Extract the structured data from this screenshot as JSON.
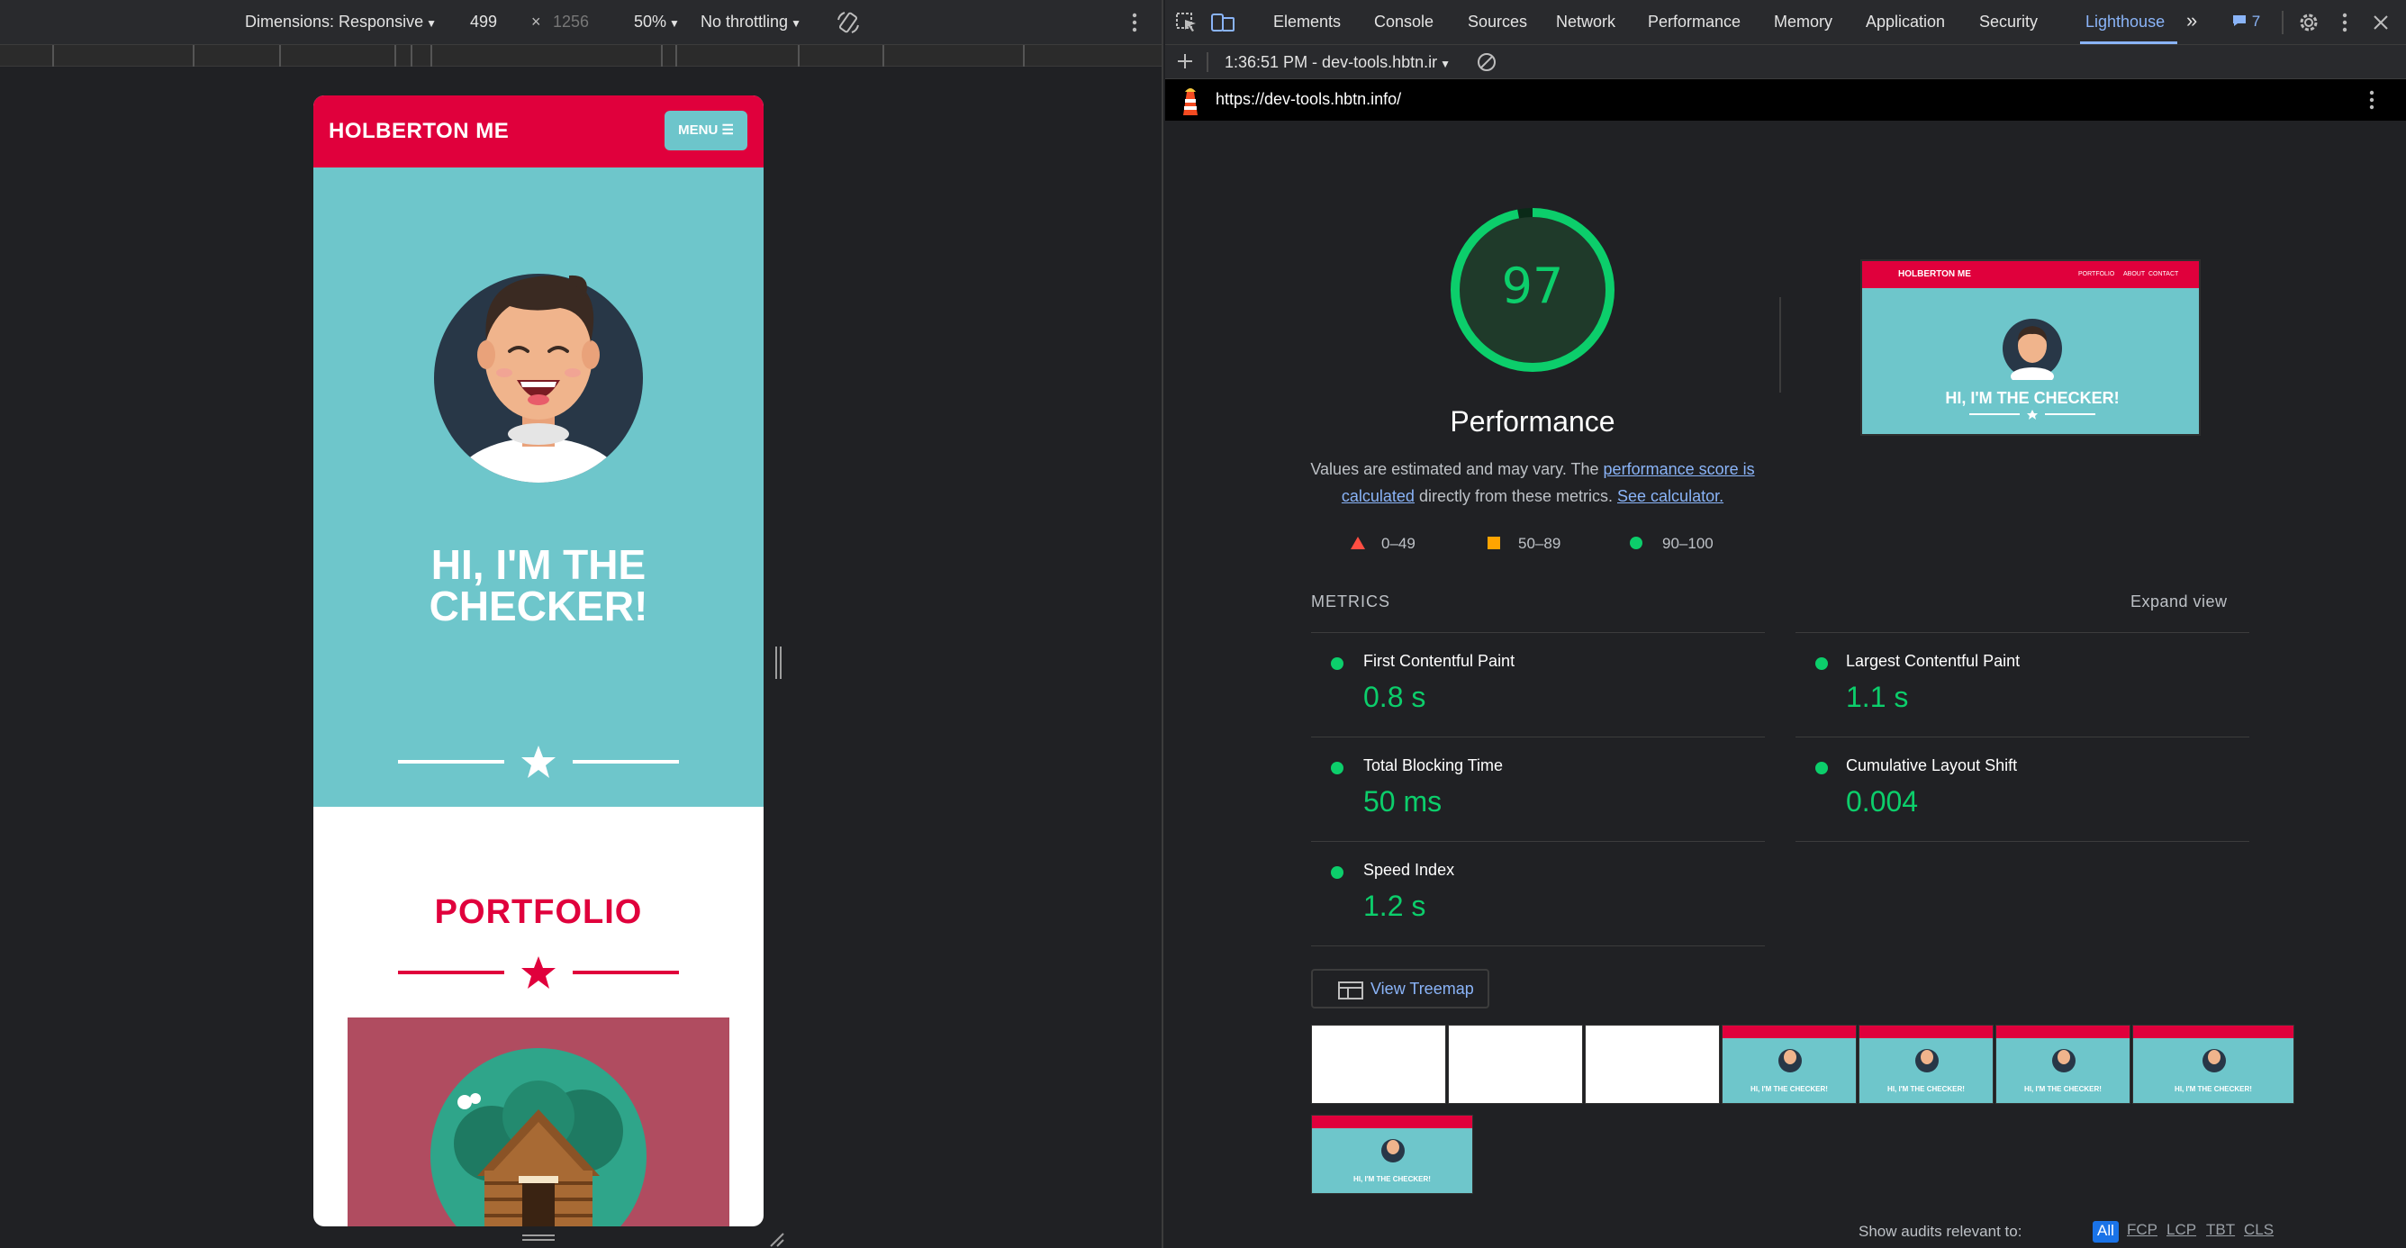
{
  "device_toolbar": {
    "dimensions_label": "Dimensions: Responsive",
    "width": "499",
    "times": "×",
    "height": "1256",
    "zoom": "50%",
    "throttling": "No throttling"
  },
  "site": {
    "logo": "HOLBERTON ME",
    "menu_button": "MENU ☰",
    "hero_title": "HI, I'M THE\nCHECKER!",
    "portfolio_title": "PORTFOLIO",
    "colors": {
      "brand_red": "#e0003c",
      "hero_teal": "#6ec6cb",
      "card_red": "#b04c60"
    }
  },
  "devtools": {
    "tabs": [
      "Elements",
      "Console",
      "Sources",
      "Network",
      "Performance",
      "Memory",
      "Application",
      "Security",
      "Lighthouse"
    ],
    "active_tab": "Lighthouse",
    "more_tabs": "»",
    "issues_count": "7",
    "report_selector": "1:36:51 PM - dev-tools.hbtn.ir",
    "url": "https://dev-tools.hbtn.info/"
  },
  "lighthouse": {
    "score": "97",
    "score_value": 0.97,
    "category": "Performance",
    "desc_prefix": "Values are estimated and may vary. The ",
    "desc_link1": "performance score is calculated",
    "desc_middle": " directly from these metrics. ",
    "desc_link2": "See calculator.",
    "legend": [
      {
        "range": "0–49",
        "color": "#ff4e42"
      },
      {
        "range": "50–89",
        "color": "#ffa400"
      },
      {
        "range": "90–100",
        "color": "#0cce6b"
      }
    ],
    "final_screenshot": {
      "logo": "HOLBERTON ME",
      "nav": [
        "PORTFOLIO",
        "ABOUT",
        "CONTACT"
      ],
      "title": "HI, I'M THE CHECKER!"
    },
    "metrics_heading": "METRICS",
    "expand_view": "Expand view",
    "metrics": [
      {
        "label": "First Contentful Paint",
        "value": "0.8 s"
      },
      {
        "label": "Largest Contentful Paint",
        "value": "1.1 s"
      },
      {
        "label": "Total Blocking Time",
        "value": "50 ms"
      },
      {
        "label": "Cumulative Layout Shift",
        "value": "0.004"
      },
      {
        "label": "Speed Index",
        "value": "1.2 s"
      }
    ],
    "view_treemap": "View Treemap",
    "filmstrip_title": "HI, I'M THE CHECKER!",
    "audits_label": "Show audits relevant to:",
    "audit_filters": [
      "All",
      "FCP",
      "LCP",
      "TBT",
      "CLS"
    ]
  }
}
